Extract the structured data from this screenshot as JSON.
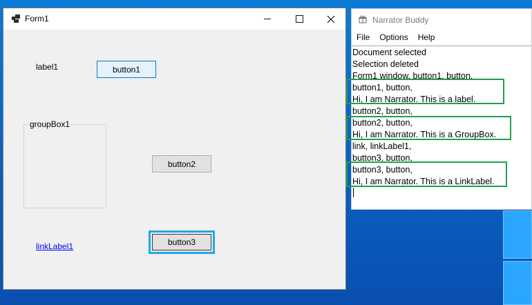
{
  "form1": {
    "title": "Form1",
    "label1": "label1",
    "button1": "button1",
    "groupbox_title": "groupBox1",
    "button2": "button2",
    "linklabel": "linkLabel1",
    "button3": "button3"
  },
  "narrator_buddy": {
    "title": "Narrator Buddy",
    "menu": [
      "File",
      "Options",
      "Help"
    ],
    "lines": [
      "Document selected",
      "Selection deleted",
      "Form1 window, button1, button,",
      "button1, button,",
      "Hi, I am Narrator. This is a label.",
      "button2, button,",
      "button2, button,",
      "Hi, I am Narrator. This is a GroupBox.",
      "link, linkLabel1,",
      "button3, button,",
      "button3, button,",
      "Hi, I am Narrator. This is a LinkLabel."
    ]
  },
  "colors": {
    "highlight_border": "#1aa34a",
    "focus_border": "#1ea7e8",
    "link": "#0000ff",
    "desktop": "#0a67c9"
  }
}
